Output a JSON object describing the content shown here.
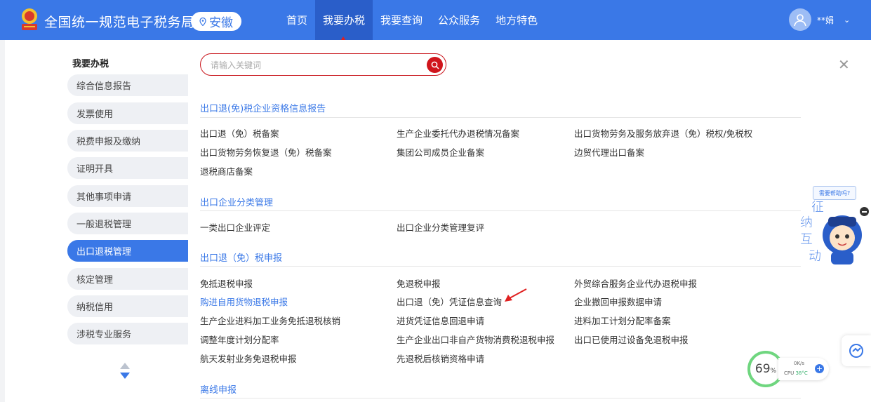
{
  "header": {
    "brand": "全国统一规范电子税务局",
    "region": "安徽",
    "nav": [
      "首页",
      "我要办税",
      "我要查询",
      "公众服务",
      "地方特色"
    ],
    "active_nav": "我要办税",
    "user_name": "**娟"
  },
  "sidebar": {
    "title": "我要办税",
    "items": [
      "综合信息报告",
      "发票使用",
      "税费申报及缴纳",
      "证明开具",
      "其他事项申请",
      "一般退税管理",
      "出口退税管理",
      "核定管理",
      "纳税信用",
      "涉税专业服务"
    ],
    "active": "出口退税管理"
  },
  "search": {
    "placeholder": "请输入关键词"
  },
  "sections": [
    {
      "title": "出口退(免)税企业资格信息报告",
      "links": [
        "出口退（免）税备案",
        "生产企业委托代办退税情况备案",
        "出口货物劳务及服务放弃退（免）税权/免税权",
        "出口货物劳务恢复退（免）税备案",
        "集团公司成员企业备案",
        "边贸代理出口备案",
        "退税商店备案"
      ]
    },
    {
      "title": "出口企业分类管理",
      "links": [
        "一类出口企业评定",
        "出口企业分类管理复评"
      ]
    },
    {
      "title": "出口退（免）税申报",
      "links": [
        "免抵退税申报",
        "免退税申报",
        "外贸综合服务企业代办退税申报",
        "购进自用货物退税申报",
        "出口退（免）凭证信息查询",
        "企业撤回申报数据申请",
        "生产企业进料加工业务免抵退税核销",
        "进货凭证信息回退申请",
        "进料加工计划分配率备案",
        "调整年度计划分配率",
        "生产企业出口非自产货物消费税退税申报",
        "出口已使用过设备免退税申报",
        "航天发射业务免退税申报",
        "先退税后核销资格申请"
      ]
    },
    {
      "title": "离线申报",
      "links": []
    }
  ],
  "widgets": {
    "helper_bubble": "需要帮助吗?",
    "helper_chars": [
      "征",
      "纳",
      "互",
      "动"
    ],
    "monitor": {
      "percent": "69",
      "unit": "%",
      "net": "0K/s",
      "cpu_label": "CPU",
      "cpu_temp": "38°C"
    }
  },
  "colors": {
    "primary": "#3a78e7",
    "accent_red": "#d0151c",
    "link_highlight": "#3a78e7"
  }
}
